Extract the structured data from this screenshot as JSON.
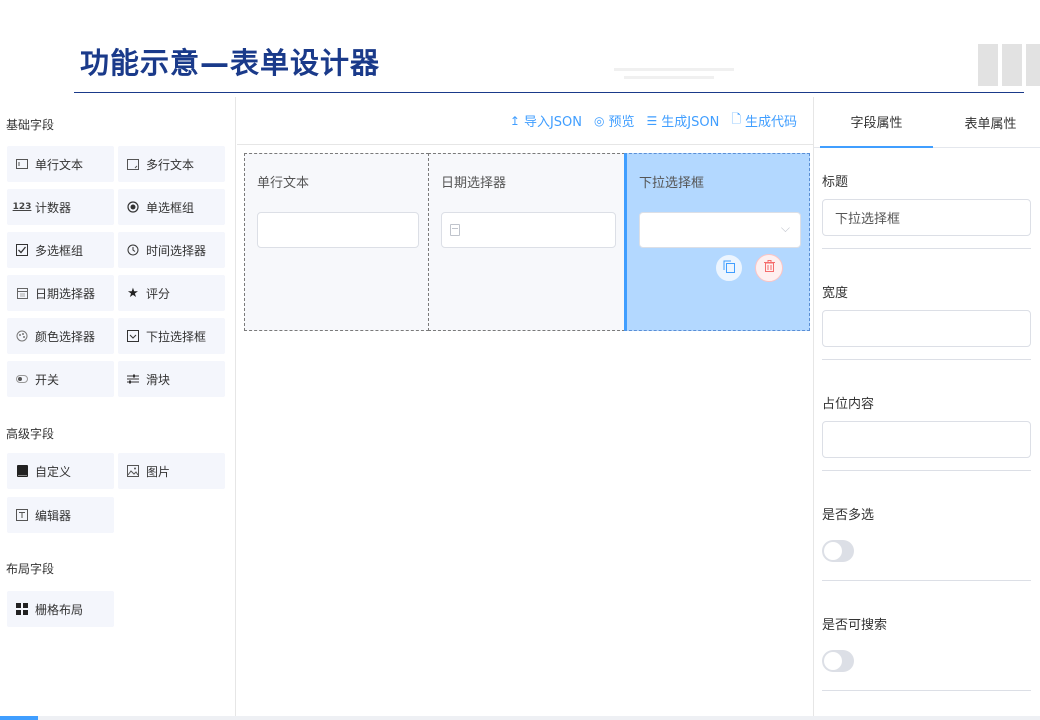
{
  "slide": {
    "title": "功能示意—表单设计器"
  },
  "left_panel": {
    "groups": [
      {
        "title": "基础字段",
        "items": [
          {
            "label": "单行文本",
            "icon": "input-icon"
          },
          {
            "label": "多行文本",
            "icon": "textarea-icon"
          },
          {
            "label": "计数器",
            "icon": "number-icon"
          },
          {
            "label": "单选框组",
            "icon": "radio-icon"
          },
          {
            "label": "多选框组",
            "icon": "checkbox-icon"
          },
          {
            "label": "时间选择器",
            "icon": "clock-icon"
          },
          {
            "label": "日期选择器",
            "icon": "calendar-icon"
          },
          {
            "label": "评分",
            "icon": "star-icon"
          },
          {
            "label": "颜色选择器",
            "icon": "color-icon"
          },
          {
            "label": "下拉选择框",
            "icon": "select-icon"
          },
          {
            "label": "开关",
            "icon": "switch-icon"
          },
          {
            "label": "滑块",
            "icon": "slider-icon"
          }
        ]
      },
      {
        "title": "高级字段",
        "items": [
          {
            "label": "自定义",
            "icon": "custom-icon"
          },
          {
            "label": "图片",
            "icon": "image-icon"
          },
          {
            "label": "编辑器",
            "icon": "editor-icon"
          }
        ]
      },
      {
        "title": "布局字段",
        "items": [
          {
            "label": "栅格布局",
            "icon": "grid-icon"
          }
        ]
      }
    ]
  },
  "toolbar": {
    "import_label": "导入JSON",
    "preview_label": "预览",
    "gen_json_label": "生成JSON",
    "gen_code_label": "生成代码"
  },
  "canvas": {
    "columns": [
      {
        "label": "单行文本",
        "type": "input",
        "active": false
      },
      {
        "label": "日期选择器",
        "type": "date",
        "active": false
      },
      {
        "label": "下拉选择框",
        "type": "select",
        "active": true
      }
    ]
  },
  "right_panel": {
    "tabs": [
      "字段属性",
      "表单属性"
    ],
    "active_tab": "字段属性",
    "props": {
      "title_label": "标题",
      "title_value": "下拉选择框",
      "width_label": "宽度",
      "width_value": "",
      "placeholder_label": "占位内容",
      "placeholder_value": "",
      "multiple_label": "是否多选",
      "multiple_value": false,
      "searchable_label": "是否可搜索",
      "searchable_value": false
    }
  },
  "colors": {
    "accent": "#409eff",
    "title": "#1a3a8a",
    "active_col": "#b3d8ff",
    "danger": "#f56c6c"
  }
}
